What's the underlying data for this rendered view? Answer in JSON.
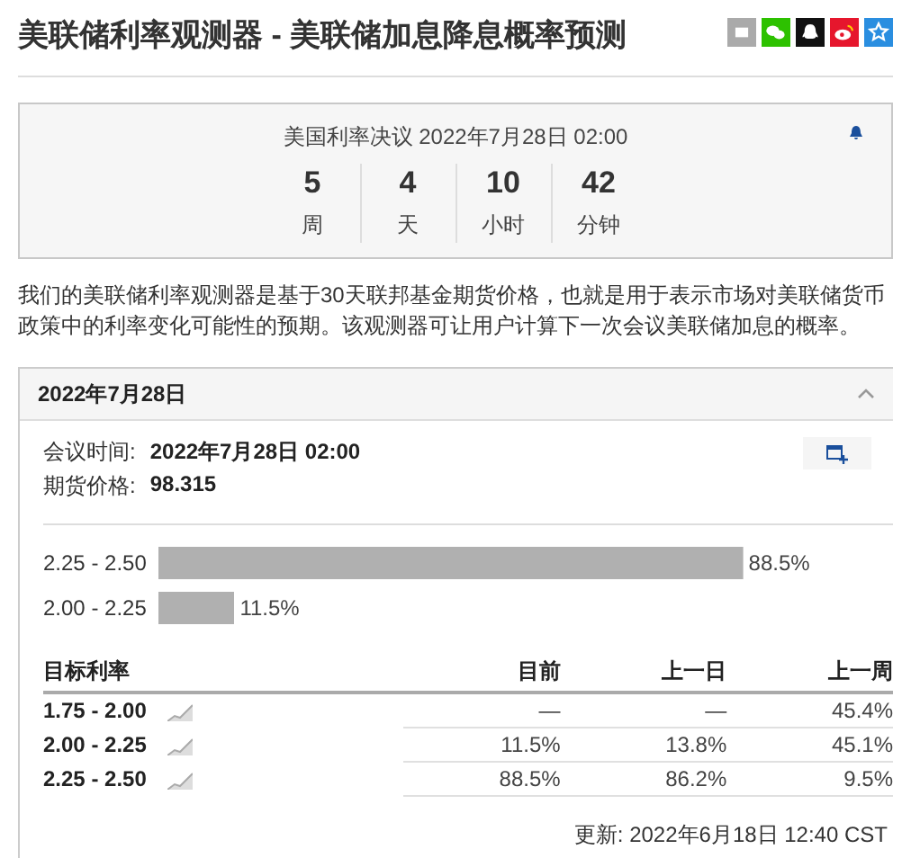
{
  "page": {
    "title": "美联储利率观测器 - 美联储加息降息概率预测"
  },
  "share_icons": [
    {
      "kind": "gray",
      "color": "#aaaaaa"
    },
    {
      "kind": "wechat",
      "color": "#2dc100"
    },
    {
      "kind": "qq",
      "color": "#111111"
    },
    {
      "kind": "weibo",
      "color": "#e6162d"
    },
    {
      "kind": "favorite",
      "color": "#2a8ee0"
    }
  ],
  "countdown": {
    "title": "美国利率决议 2022年7月28日 02:00",
    "units": [
      {
        "value": "5",
        "label": "周"
      },
      {
        "value": "4",
        "label": "天"
      },
      {
        "value": "10",
        "label": "小时"
      },
      {
        "value": "42",
        "label": "分钟"
      }
    ]
  },
  "description": "我们的美联储利率观测器是基于30天联邦基金期货价格，也就是用于表示市场对美联储货币政策中的利率变化可能性的预期。该观测器可让用户计算下一次会议美联储加息的概率。",
  "meeting": {
    "header": "2022年7月28日",
    "expanded": true,
    "info": [
      {
        "label": "会议时间:",
        "value": "2022年7月28日 02:00"
      },
      {
        "label": "期货价格:",
        "value": "98.315"
      }
    ],
    "chart_data": {
      "type": "bar",
      "orientation": "horizontal",
      "categories": [
        "2.25 - 2.50",
        "2.00 - 2.25"
      ],
      "values": [
        88.5,
        11.5
      ],
      "data_labels": true,
      "value_labels": [
        "88.5%",
        "11.5%"
      ]
    },
    "table": {
      "columns": [
        "目标利率",
        "目前",
        "上一日",
        "上一周"
      ],
      "rows": [
        {
          "rate": "1.75 - 2.00",
          "current": "—",
          "prev_day": "—",
          "prev_week": "45.4%"
        },
        {
          "rate": "2.00 - 2.25",
          "current": "11.5%",
          "prev_day": "13.8%",
          "prev_week": "45.1%"
        },
        {
          "rate": "2.25 - 2.50",
          "current": "88.5%",
          "prev_day": "86.2%",
          "prev_week": "9.5%"
        }
      ]
    },
    "updated": "更新: 2022年6月18日 12:40 CST"
  }
}
